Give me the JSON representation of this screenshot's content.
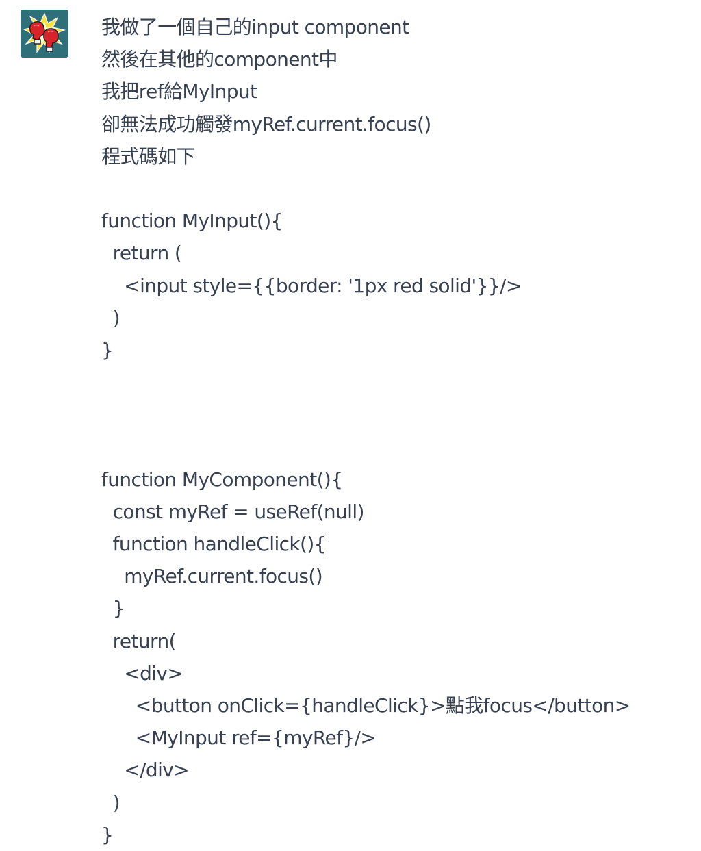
{
  "message": {
    "avatar_icon": "boxing-gloves-icon",
    "lines": [
      "我做了一個自己的input component",
      "然後在其他的component中",
      "我把ref給MyInput",
      "卻無法成功觸發myRef.current.focus()",
      "程式碼如下",
      "",
      "function MyInput(){",
      "  return (",
      "    <input style={{border: '1px red solid'}}/>",
      "  )",
      "}",
      "",
      "",
      "",
      "function MyComponent(){",
      "  const myRef = useRef(null)",
      "  function handleClick(){",
      "    myRef.current.focus()",
      "  }",
      "  return(",
      "    <div>",
      "      <button onClick={handleClick}>點我focus</button>",
      "      <MyInput ref={myRef}/>",
      "    </div>",
      "  )",
      "}"
    ]
  },
  "colors": {
    "text": "#374151",
    "avatar_bg": "#2f6f7a",
    "glove_red": "#d8232a",
    "burst_yellow": "#f6e23a"
  }
}
